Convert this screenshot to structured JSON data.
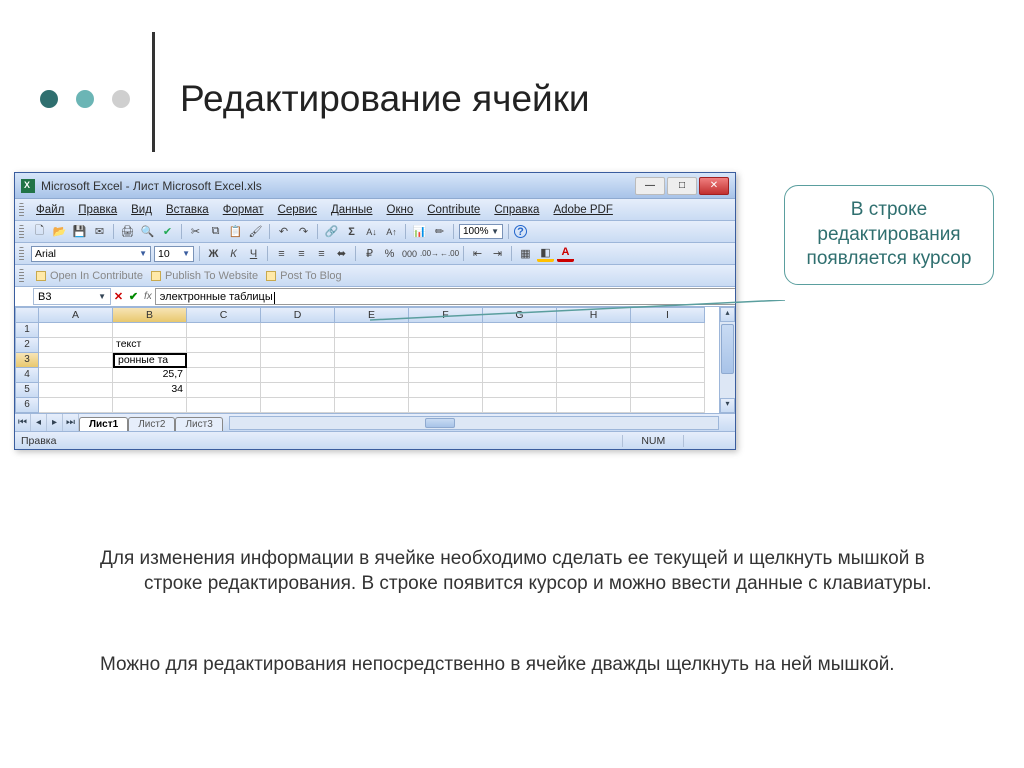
{
  "slide": {
    "title": "Редактирование ячейки",
    "callout": "В строке редактирования появляется курсор",
    "para1": "Для изменения информации в ячейке необходимо сделать ее текущей и щелкнуть мышкой в строке редактирования.  В строке появится курсор и можно ввести данные с клавиатуры.",
    "para2": "Можно для редактирования непосредственно в ячейке дважды щелкнуть на ней мышкой."
  },
  "window": {
    "title": "Microsoft Excel - Лист Microsoft Excel.xls",
    "menus": [
      "Файл",
      "Правка",
      "Вид",
      "Вставка",
      "Формат",
      "Сервис",
      "Данные",
      "Окно",
      "Contribute",
      "Справка",
      "Adobe PDF"
    ],
    "font_name": "Arial",
    "font_size": "10",
    "zoom": "100%",
    "contribute": {
      "open": "Open In Contribute",
      "publish": "Publish To Website",
      "post": "Post To Blog"
    },
    "name_box": "B3",
    "formula_text": "электронные таблицы",
    "columns": [
      "A",
      "B",
      "C",
      "D",
      "E",
      "F",
      "G",
      "H",
      "I"
    ],
    "rows": [
      "1",
      "2",
      "3",
      "4",
      "5",
      "6"
    ],
    "cells": {
      "b2": "текст",
      "b3": "ронные та",
      "b4": "25,7",
      "b5": "34"
    },
    "sheets": [
      "Лист1",
      "Лист2",
      "Лист3"
    ],
    "status_left": "Правка",
    "status_num": "NUM"
  }
}
